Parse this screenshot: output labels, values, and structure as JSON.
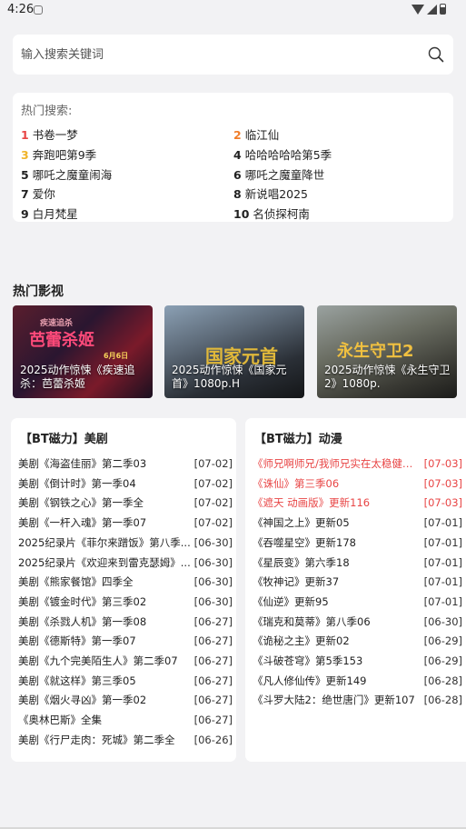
{
  "status": {
    "time": "4:26"
  },
  "search": {
    "placeholder": "输入搜索关键词"
  },
  "hot_search": {
    "title": "热门搜索:",
    "items": [
      {
        "num": "1",
        "label": "书卷一梦",
        "color": "#e84545"
      },
      {
        "num": "2",
        "label": "临江仙",
        "color": "#f07d2a"
      },
      {
        "num": "3",
        "label": "奔跑吧第9季",
        "color": "#f0b429"
      },
      {
        "num": "4",
        "label": "哈哈哈哈哈第5季",
        "color": "#222222"
      },
      {
        "num": "5",
        "label": "哪吒之魔童闹海",
        "color": "#222222"
      },
      {
        "num": "6",
        "label": "哪吒之魔童降世",
        "color": "#222222"
      },
      {
        "num": "7",
        "label": "爱你",
        "color": "#222222"
      },
      {
        "num": "8",
        "label": "新说唱2025",
        "color": "#222222"
      },
      {
        "num": "9",
        "label": "白月梵星",
        "color": "#222222"
      },
      {
        "num": "10",
        "label": "名侦探柯南",
        "color": "#222222"
      }
    ]
  },
  "hot_movies": {
    "title": "热门影视",
    "items": [
      {
        "caption": "2025动作惊悚《疾速追杀：芭蕾杀姬"
      },
      {
        "caption": "2025动作惊悚《国家元首》1080p.H"
      },
      {
        "caption": "2025动作惊悚《永生守卫2》1080p."
      }
    ]
  },
  "us_series": {
    "title": "【BT磁力】美剧",
    "rows": [
      {
        "title": "美剧《海盗佳丽》第二季03",
        "date": "[07-02]",
        "hot": false
      },
      {
        "title": "美剧《倒计时》第一季04",
        "date": "[07-02]",
        "hot": false
      },
      {
        "title": "美剧《钢铁之心》第一季全",
        "date": "[07-02]",
        "hot": false
      },
      {
        "title": "美剧《一杆入魂》第一季07",
        "date": "[07-02]",
        "hot": false
      },
      {
        "title": "2025纪录片《菲尔来蹭饭》第八季...",
        "date": "[06-30]",
        "hot": false
      },
      {
        "title": "2025纪录片《欢迎来到雷克瑟姆》...",
        "date": "[06-30]",
        "hot": false
      },
      {
        "title": "美剧《熊家餐馆》四季全",
        "date": "[06-30]",
        "hot": false
      },
      {
        "title": "美剧《镀金时代》第三季02",
        "date": "[06-30]",
        "hot": false
      },
      {
        "title": "美剧《杀戮人机》第一季08",
        "date": "[06-27]",
        "hot": false
      },
      {
        "title": "美剧《德斯特》第一季07",
        "date": "[06-27]",
        "hot": false
      },
      {
        "title": "美剧《九个完美陌生人》第二季07",
        "date": "[06-27]",
        "hot": false
      },
      {
        "title": "美剧《就这样》第三季05",
        "date": "[06-27]",
        "hot": false
      },
      {
        "title": "美剧《烟火寻凶》第一季02",
        "date": "[06-27]",
        "hot": false
      },
      {
        "title": "《奥林巴斯》全集",
        "date": "[06-27]",
        "hot": false
      },
      {
        "title": "美剧《行尸走肉：死城》第二季全",
        "date": "[06-26]",
        "hot": false
      }
    ]
  },
  "anime": {
    "title": "【BT磁力】动漫",
    "rows": [
      {
        "title": "《师兄啊师兄/我师兄实在太稳健了...",
        "date": "[07-03]",
        "hot": true
      },
      {
        "title": "《诛仙》第三季06",
        "date": "[07-03]",
        "hot": true
      },
      {
        "title": "《遮天 动画版》更新116",
        "date": "[07-03]",
        "hot": true
      },
      {
        "title": "《神国之上》更新05",
        "date": "[07-01]",
        "hot": false
      },
      {
        "title": "《吞噬星空》更新178",
        "date": "[07-01]",
        "hot": false
      },
      {
        "title": "《星辰变》第六季18",
        "date": "[07-01]",
        "hot": false
      },
      {
        "title": "《牧神记》更新37",
        "date": "[07-01]",
        "hot": false
      },
      {
        "title": "《仙逆》更新95",
        "date": "[07-01]",
        "hot": false
      },
      {
        "title": "《瑞克和莫蒂》第八季06",
        "date": "[06-30]",
        "hot": false
      },
      {
        "title": "《诡秘之主》更新02",
        "date": "[06-29]",
        "hot": false
      },
      {
        "title": "《斗破苍穹》第5季153",
        "date": "[06-29]",
        "hot": false
      },
      {
        "title": "《凡人修仙传》更新149",
        "date": "[06-28]",
        "hot": false
      },
      {
        "title": "《斗罗大陆2：绝世唐门》更新107",
        "date": "[06-28]",
        "hot": false
      }
    ]
  },
  "colors": {
    "accent_red": "#e84545",
    "background": "#f2f2f4",
    "card": "#ffffff"
  }
}
